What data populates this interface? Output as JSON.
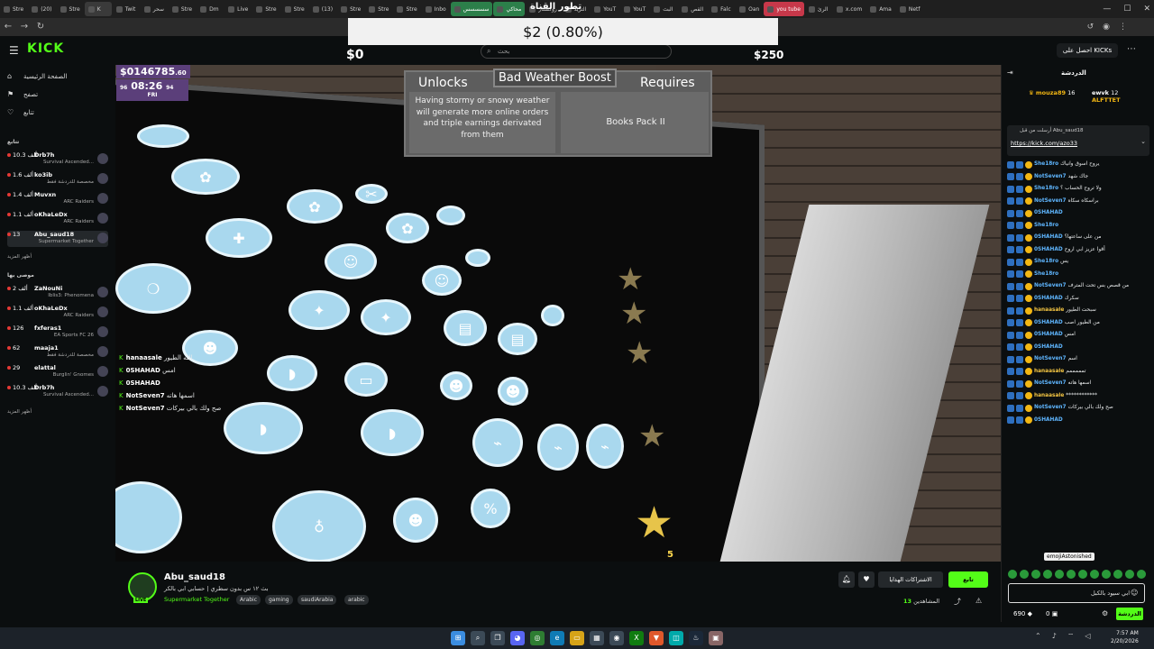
{
  "browser": {
    "tabs": [
      {
        "label": "Stre",
        "style": "normal"
      },
      {
        "label": "(20)",
        "style": "normal"
      },
      {
        "label": "Stre",
        "style": "normal"
      },
      {
        "label": "K",
        "style": "active"
      },
      {
        "label": "Twit",
        "style": "normal"
      },
      {
        "label": "سحر",
        "style": "normal"
      },
      {
        "label": "Stre",
        "style": "normal"
      },
      {
        "label": "Dm",
        "style": "normal"
      },
      {
        "label": "Live",
        "style": "normal"
      },
      {
        "label": "Stre",
        "style": "normal"
      },
      {
        "label": "Stre",
        "style": "normal"
      },
      {
        "label": "(13)",
        "style": "normal"
      },
      {
        "label": "Stre",
        "style": "normal"
      },
      {
        "label": "Stre",
        "style": "normal"
      },
      {
        "label": "Stre",
        "style": "normal"
      },
      {
        "label": "Inbo",
        "style": "normal"
      },
      {
        "label": "سسسسس",
        "style": "green"
      },
      {
        "label": "محاكي",
        "style": "green"
      },
      {
        "label": "روكستار",
        "style": "normal"
      },
      {
        "label": "التريد",
        "style": "normal"
      },
      {
        "label": "YouT",
        "style": "normal"
      },
      {
        "label": "YouT",
        "style": "normal"
      },
      {
        "label": "البث",
        "style": "normal"
      },
      {
        "label": "القص",
        "style": "normal"
      },
      {
        "label": "Falc",
        "style": "normal"
      },
      {
        "label": "Oan",
        "style": "normal"
      },
      {
        "label": "you tube",
        "style": "red"
      },
      {
        "label": "الرئ",
        "style": "normal"
      },
      {
        "label": "x.com",
        "style": "normal"
      },
      {
        "label": "Ama",
        "style": "normal"
      },
      {
        "label": "Netf",
        "style": "normal"
      }
    ],
    "address_tab": "saud18"
  },
  "header": {
    "logo": "KICK",
    "search_placeholder": "بحث",
    "get_kicks": "احصل على KICKs"
  },
  "overlay": {
    "goal_title": "تطور القناة",
    "goal_value": "$2 (0.80%)",
    "goal_min": "$0",
    "goal_max": "$250"
  },
  "sidebar": {
    "nav": [
      {
        "label": "الصفحة الرئيسية",
        "icon": "home-icon"
      },
      {
        "label": "تصفح",
        "icon": "browse-icon"
      },
      {
        "label": "تتابع",
        "icon": "heart-icon"
      }
    ],
    "following_header": "تتابع",
    "following": [
      {
        "count": "10.3 ألف",
        "name": "Drb7h",
        "game": "Survival Ascended..."
      },
      {
        "count": "1.6 ألف",
        "name": "ko3ib",
        "game": "مخصصة للدردشة فقط"
      },
      {
        "count": "1.4 ألف",
        "name": "Muvxn",
        "game": "ARC Raiders"
      },
      {
        "count": "1.1 ألف",
        "name": "oKhaLeDx",
        "game": "ARC Raiders"
      },
      {
        "count": "13",
        "name": "Abu_saud18",
        "game": "Supermarket Together"
      }
    ],
    "show_more_1": "أظهر المزيد",
    "recommended_header": "موصى بها",
    "recommended": [
      {
        "count": "2 ألف",
        "name": "ZaNouNi",
        "game": "Iblis3: Phenomena"
      },
      {
        "count": "1.1 ألف",
        "name": "oKhaLeDx",
        "game": "ARC Raiders"
      },
      {
        "count": "126",
        "name": "fxferas1",
        "game": "EA Sports FC 26"
      },
      {
        "count": "62",
        "name": "maaja1",
        "game": "مخصصة للدردشة فقط"
      },
      {
        "count": "29",
        "name": "elattal",
        "game": "Burglin' Gnomes"
      },
      {
        "count": "10.3 ألف",
        "name": "Drb7h",
        "game": "Survival Ascended..."
      }
    ],
    "show_more_2": "أظهر المزيد"
  },
  "game": {
    "money": "$0146785",
    "money_suffix": ".60",
    "day_num": "96",
    "time": "08:26",
    "day": "FRI",
    "day_right": "94",
    "unlock_title": "Bad Weather Boost",
    "unlocks_label": "Unlocks",
    "requires_label": "Requires",
    "unlock_desc": "Having stormy or snowy weather will generate more online orders and triple earnings derivated from them",
    "requires_value": "Books Pack II",
    "star_level": "5",
    "overlay_chat": [
      {
        "user": "hanaasale",
        "text": "الله الطيور"
      },
      {
        "user": "0SHAHAD",
        "text": "امس"
      },
      {
        "user": "0SHAHAD",
        "text": ""
      },
      {
        "user": "NotSeven7",
        "text": "اسمها هاته"
      },
      {
        "user": "NotSeven7",
        "text": "صح ولك بالي بيركات"
      }
    ]
  },
  "stream": {
    "streamer": "Abu_saud18",
    "live_badge": "LIVE",
    "title": "بث ١٢ س بدون سطري | حسابي ابي بالكر",
    "category": "Supermarket Together",
    "tags": [
      "Arabic",
      "gaming",
      "saudiArabia",
      "arabic"
    ],
    "follow_label": "تابع",
    "subscribe_label": "الاشتراكات الهدايا",
    "viewers_label": "المشاهدين",
    "viewers_count": "13"
  },
  "chat": {
    "title": "الدردشة",
    "gifter1_name": "mouza89",
    "gifter1_count": "16",
    "gifter2_name": "ewvk",
    "gifter2_count": "12",
    "gifter3_name": "ALFTTET",
    "pinned_by": "أرسلت من قبل Abu_saud18",
    "pinned_link": "https://kick.com/azo33",
    "messages": [
      {
        "user": "She18ro",
        "color": "#5fb6ff",
        "text": "يروح اسوق وانياك"
      },
      {
        "user": "NotSeven7",
        "color": "#5fb6ff",
        "text": "جاك شهد"
      },
      {
        "user": "She18ro",
        "color": "#5fb6ff",
        "text": "ولا تروح الحساب ؟"
      },
      {
        "user": "NotSeven7",
        "color": "#5fb6ff",
        "text": "براسكاه سكاه"
      },
      {
        "user": "0SHAHAD",
        "color": "#5fb6ff",
        "text": ""
      },
      {
        "user": "She18ro",
        "color": "#5fb6ff",
        "text": ""
      },
      {
        "user": "0SHAHAD",
        "color": "#5fb6ff",
        "text": "من على ساعتها؟"
      },
      {
        "user": "0SHAHAD",
        "color": "#5fb6ff",
        "text": "أقوا عزيز ابي اروح"
      },
      {
        "user": "She18ro",
        "color": "#5fb6ff",
        "text": "يس"
      },
      {
        "user": "She18ro",
        "color": "#5fb6ff",
        "text": ""
      },
      {
        "user": "NotSeven7",
        "color": "#5fb6ff",
        "text": "من قصص بس تحت المترف"
      },
      {
        "user": "0SHAHAD",
        "color": "#5fb6ff",
        "text": "سكرك"
      },
      {
        "user": "hanaasale",
        "color": "#f4c542",
        "text": "سبحت الطيور"
      },
      {
        "user": "0SHAHAD",
        "color": "#5fb6ff",
        "text": "من الطيور اصب"
      },
      {
        "user": "0SHAHAD",
        "color": "#5fb6ff",
        "text": "امس"
      },
      {
        "user": "0SHAHAD",
        "color": "#5fb6ff",
        "text": ""
      },
      {
        "user": "NotSeven7",
        "color": "#5fb6ff",
        "text": "اسم"
      },
      {
        "user": "hanaasale",
        "color": "#f4c542",
        "text": "تمممممم"
      },
      {
        "user": "NotSeven7",
        "color": "#5fb6ff",
        "text": "اسمها هاته"
      },
      {
        "user": "hanaasale",
        "color": "#f4c542",
        "text": "************"
      },
      {
        "user": "NotSeven7",
        "color": "#5fb6ff",
        "text": "صح ولك بالي بيركات"
      },
      {
        "user": "0SHAHAD",
        "color": "#5fb6ff",
        "text": ""
      }
    ],
    "emote_tooltip": "emojiAstonished",
    "input_placeholder": "ابي سيود بالكبل",
    "points": "690",
    "points2": "0",
    "chat_button": "الدردشة"
  },
  "taskbar": {
    "time": "7:57 AM",
    "date": "2/20/2026"
  }
}
